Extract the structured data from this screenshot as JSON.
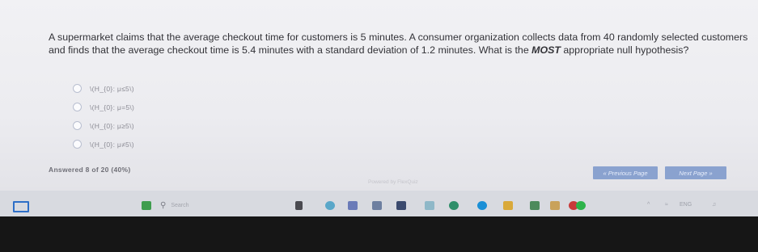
{
  "question": {
    "text": "A supermarket claims that the average checkout time for customers is 5 minutes. A consumer organization collects data from 40 randomly selected customers and finds that the average checkout time is 5.4 minutes with a standard deviation of 1.2 minutes. What is the ",
    "emphasis": "MOST",
    "text_end": " appropriate null hypothesis?"
  },
  "options": [
    {
      "label": "\\(H_{0}: μ≤5\\)"
    },
    {
      "label": "\\(H_{0}: μ=5\\)"
    },
    {
      "label": "\\(H_{0}: μ≥5\\)"
    },
    {
      "label": "\\(H_{0}: μ≠5\\)"
    }
  ],
  "progress": {
    "text": "Answered 8 of 20 (40%)",
    "answered": 8,
    "total": 20,
    "percent": 40
  },
  "footer": {
    "powered_by": "Powered by FlexQuiz"
  },
  "navigation": {
    "previous_label": "« Previous Page",
    "next_label": "Next Page »"
  },
  "taskbar": {
    "search_placeholder": "Search",
    "tray_lang": "ENG",
    "icons": [
      "windows-start-icon",
      "widgets-icon",
      "search-icon",
      "file-explorer-icon",
      "app-icon",
      "browser-icon",
      "store-icon",
      "mail-icon",
      "chrome-icon",
      "edge-icon",
      "teams-icon"
    ],
    "colors": {
      "accent": "#2e6fc7",
      "button": "#8aa2cf"
    }
  }
}
